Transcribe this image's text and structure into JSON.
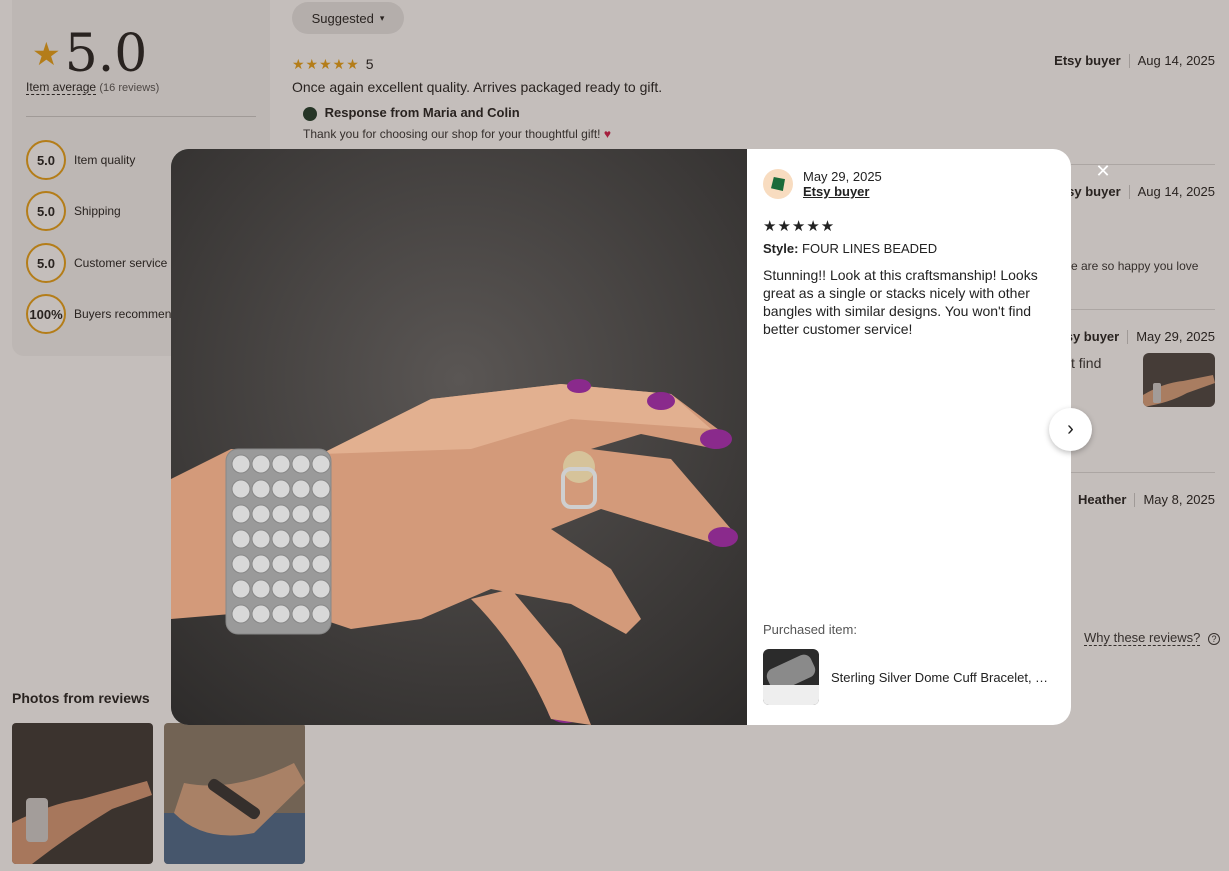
{
  "summary": {
    "rating": "5.0",
    "avg_label": "Item average",
    "review_count": "(16 reviews)",
    "metrics": [
      {
        "value": "5.0",
        "label": "Item quality"
      },
      {
        "value": "5.0",
        "label": "Shipping"
      },
      {
        "value": "5.0",
        "label": "Customer service"
      },
      {
        "value": "100%",
        "label": "Buyers recommend"
      }
    ]
  },
  "sort": {
    "label": "Suggested"
  },
  "reviews": [
    {
      "rating": "5",
      "text": "Once again excellent quality. Arrives packaged ready to gift.",
      "author": "Etsy buyer",
      "date": "Aug 14, 2025",
      "response_title": "Response from Maria and Colin",
      "response_text": "Thank you for choosing our shop for your thoughtful gift!"
    },
    {
      "author": "Etsy buyer",
      "date": "Aug 14, 2025",
      "snippet": "e are so happy you love"
    },
    {
      "author": "Etsy buyer",
      "date": "May 29, 2025",
      "snippet": "t find"
    },
    {
      "author": "Heather",
      "date": "May 8, 2025"
    }
  ],
  "why": {
    "label": "Why these reviews?"
  },
  "photos": {
    "title": "Photos from reviews"
  },
  "modal": {
    "date": "May 29, 2025",
    "author": "Etsy buyer",
    "stars": "★★★★★",
    "style_label": "Style:",
    "style_value": "FOUR LINES BEADED",
    "text": "Stunning!! Look at this craftsmanship! Looks great as a single or stacks nicely with other bangles with similar designs. You won't find better customer service!",
    "purchased_label": "Purchased item:",
    "item_title": "Sterling Silver Dome Cuff Bracelet, Ta..."
  },
  "icons": {
    "close": "close-icon",
    "next": "chevron-right-icon",
    "star": "star-icon",
    "help": "help-icon"
  },
  "colors": {
    "accent": "#e8a317",
    "overlay": "#c9bdb6",
    "heart": "#d11a4a"
  }
}
